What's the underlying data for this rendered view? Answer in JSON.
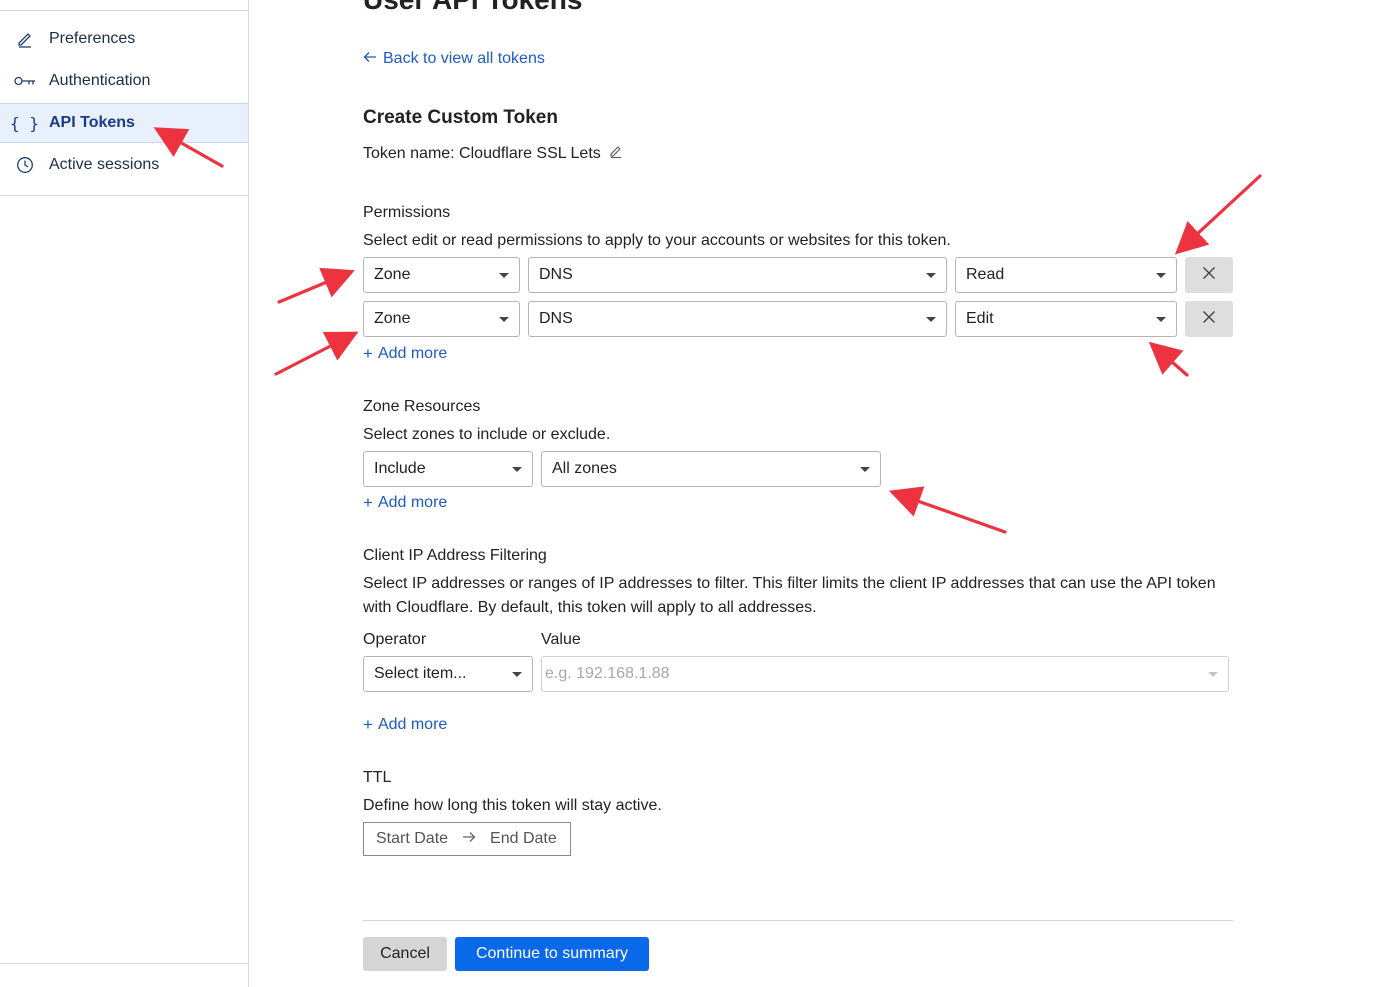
{
  "sidebar": {
    "items": [
      {
        "label": "Preferences",
        "icon": "pencil-icon",
        "active": false
      },
      {
        "label": "Authentication",
        "icon": "key-icon",
        "active": false
      },
      {
        "label": "API Tokens",
        "icon": "braces-icon",
        "active": true
      },
      {
        "label": "Active sessions",
        "icon": "clock-icon",
        "active": false
      }
    ]
  },
  "header": {
    "title": "User API Tokens",
    "back_link": "Back to view all tokens"
  },
  "form": {
    "title": "Create Custom Token",
    "token_name": "Token name: Cloudflare SSL Lets",
    "permissions": {
      "label": "Permissions",
      "description": "Select edit or read permissions to apply to your accounts or websites for this token.",
      "rows": [
        {
          "scope": "Zone",
          "resource": "DNS",
          "access": "Read"
        },
        {
          "scope": "Zone",
          "resource": "DNS",
          "access": "Edit"
        }
      ],
      "add_more": "Add more"
    },
    "zone_resources": {
      "label": "Zone Resources",
      "description": "Select zones to include or exclude.",
      "mode": "Include",
      "zones": "All zones",
      "add_more": "Add more"
    },
    "ip_filtering": {
      "label": "Client IP Address Filtering",
      "description": "Select IP addresses or ranges of IP addresses to filter. This filter limits the client IP addresses that can use the API token with Cloudflare. By default, this token will apply to all addresses.",
      "operator_label": "Operator",
      "value_label": "Value",
      "operator_placeholder": "Select item...",
      "value_placeholder": "e.g. 192.168.1.88",
      "add_more": "Add more"
    },
    "ttl": {
      "label": "TTL",
      "description": "Define how long this token will stay active.",
      "start": "Start Date",
      "end": "End Date"
    }
  },
  "footer": {
    "cancel": "Cancel",
    "continue": "Continue to summary"
  },
  "colors": {
    "link": "#1d5bbf",
    "primary_button": "#0a69e8",
    "annotation_arrow": "#ee3340",
    "active_nav_bg": "#e8f0fb"
  }
}
